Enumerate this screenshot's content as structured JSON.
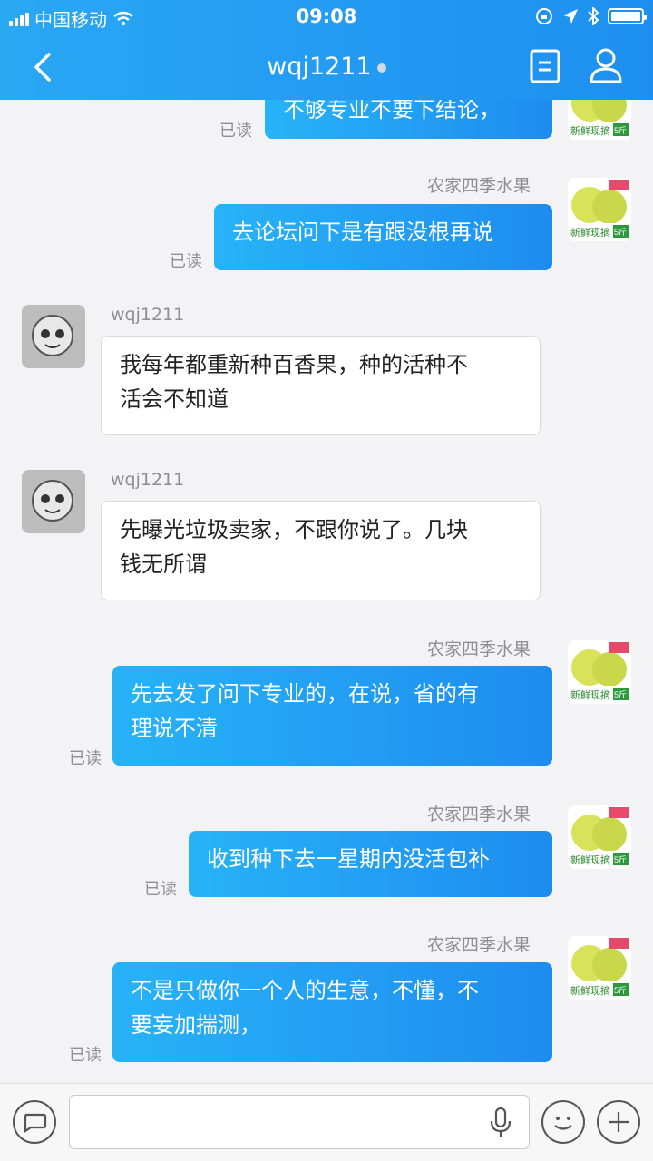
{
  "status_bar": {
    "carrier": "中国移动",
    "time": "09:08"
  },
  "header": {
    "title": "wqj1211"
  },
  "messages": [
    {
      "side": "out",
      "sender": "",
      "text": "不够专业不要下结论，",
      "read": "已读"
    },
    {
      "side": "out",
      "sender": "农家四季水果",
      "text": "去论坛问下是有跟没根再说",
      "read": "已读"
    },
    {
      "side": "in",
      "sender": "wqj1211",
      "line1": "我每年都重新种百香果，种的活种不",
      "line2": "活会不知道"
    },
    {
      "side": "in",
      "sender": "wqj1211",
      "line1": "先曝光垃圾卖家，不跟你说了。几块",
      "line2": "钱无所谓"
    },
    {
      "side": "out",
      "sender": "农家四季水果",
      "line1": "先去发了问下专业的，在说，省的有",
      "line2": "理说不清",
      "read": "已读"
    },
    {
      "side": "out",
      "sender": "农家四季水果",
      "text": "收到种下去一星期内没活包补",
      "read": "已读"
    },
    {
      "side": "out",
      "sender": "农家四季水果",
      "line1": "不是只做你一个人的生意，不懂，不",
      "line2": "要妄加揣测，",
      "read": "已读"
    }
  ],
  "avatar_text": {
    "pear_label": "新鲜现摘",
    "pear_badge": "5斤"
  },
  "colors": {
    "header": "#1e8ff0",
    "bubble_out": "#27b3f8",
    "background": "#f3f3f6"
  },
  "icons": [
    "back-arrow-icon",
    "document-icon",
    "user-icon",
    "chat-bubble-icon",
    "microphone-icon",
    "smiley-icon",
    "plus-icon",
    "wifi-icon",
    "battery-icon"
  ]
}
